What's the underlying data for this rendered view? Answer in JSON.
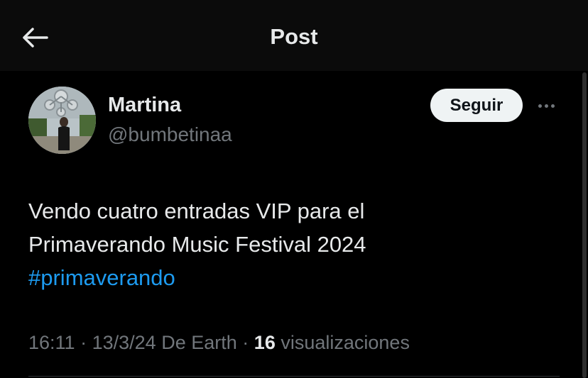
{
  "header": {
    "title": "Post"
  },
  "author": {
    "name": "Martina",
    "handle": "@bumbetinaa",
    "follow_label": "Seguir"
  },
  "post": {
    "text_line1": "Vendo cuatro entradas VIP para el",
    "text_line2": "Primaverando Music Festival 2024",
    "hashtag": "#primaverando"
  },
  "meta": {
    "time": "16:11",
    "date": "13/3/24",
    "source": "De Earth",
    "views_count": "16",
    "views_label": "visualizaciones",
    "separator": "·"
  },
  "colors": {
    "background": "#000000",
    "accent": "#1d9bf0",
    "secondary_text": "#71767b",
    "primary_text": "#e7e9ea"
  },
  "icons": {
    "back": "arrow-left-icon",
    "more": "more-horizontal-icon"
  }
}
